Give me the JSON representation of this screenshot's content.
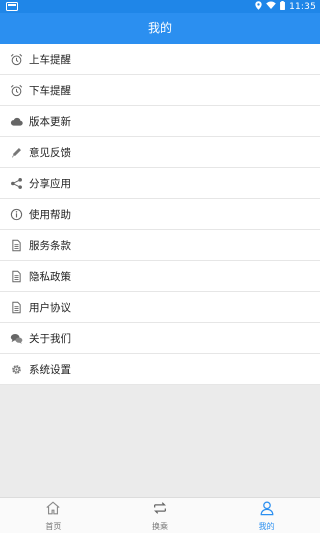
{
  "status_bar": {
    "time": "11:35"
  },
  "header": {
    "title": "我的"
  },
  "menu": {
    "items": [
      {
        "label": "上车提醒",
        "icon": "alarm-clock-icon"
      },
      {
        "label": "下车提醒",
        "icon": "alarm-clock-icon"
      },
      {
        "label": "版本更新",
        "icon": "cloud-icon"
      },
      {
        "label": "意见反馈",
        "icon": "pencil-icon"
      },
      {
        "label": "分享应用",
        "icon": "share-icon"
      },
      {
        "label": "使用帮助",
        "icon": "info-icon"
      },
      {
        "label": "服务条款",
        "icon": "document-icon"
      },
      {
        "label": "隐私政策",
        "icon": "document-icon"
      },
      {
        "label": "用户协议",
        "icon": "document-icon"
      },
      {
        "label": "关于我们",
        "icon": "chat-bubbles-icon"
      },
      {
        "label": "系统设置",
        "icon": "gear-icon"
      }
    ]
  },
  "tabs": [
    {
      "label": "首页",
      "icon": "home-icon",
      "active": false
    },
    {
      "label": "换乘",
      "icon": "transfer-icon",
      "active": false
    },
    {
      "label": "我的",
      "icon": "user-icon",
      "active": true
    }
  ],
  "colors": {
    "accent": "#2b8ff0",
    "status_bar": "#1f86e8",
    "background": "#ebebeb"
  }
}
